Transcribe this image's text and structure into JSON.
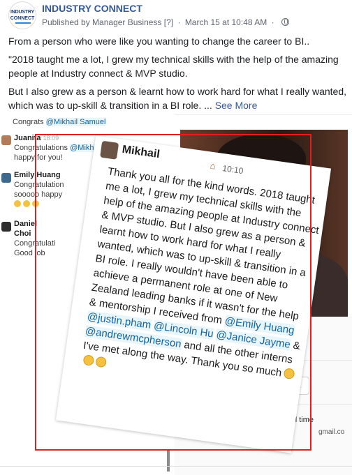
{
  "post": {
    "avatar_line1": "INDUSTRY",
    "avatar_line2": "CONNECT",
    "page_name": "INDUSTRY CONNECT",
    "published_by": "Published by Manager Business",
    "help_mark": "[?]",
    "date": "March 15 at 10:48 AM",
    "privacy_icon": "globe-icon",
    "paragraphs": [
      "From a person who were like you wanting to change the career to BI..",
      "\"2018 taught me a lot, I grew my technical skills with the help of the amazing people at Industry connect & MVP studio.",
      "But I also grew as a person & learnt how to work hard for what I really wanted, which was to up-skill & transition in a BI role. ..."
    ],
    "see_more": "See More"
  },
  "slack": {
    "top_line_prefix": "Congrats",
    "top_line_mention": "@Mikhail Samuel",
    "messages": [
      {
        "name": "Juanita",
        "time": "18:09",
        "text_prefix": "Congratulations",
        "mention": "@Mikhail Samuel",
        "text_suffix": ". So happy for you!"
      },
      {
        "name": "Emily Huang",
        "text": "Congratulation sooooo happy"
      },
      {
        "name": "Daniel Choi",
        "text": "Congratulati Good job"
      }
    ]
  },
  "card": {
    "name": "Mikhail",
    "time": "10:10",
    "body_parts": [
      {
        "t": "Thank you all for the kind words. 2018 taught me a lot, I grew my technical skills with the help of the amazing people at Industry connect & MVP studio. But I also grew as a person & learnt how to work hard for what I really wanted, which was to up-skill & transition in a BI role. I really wouldn't have been able to achieve a permanent role at one of New Zealand leading banks if it wasn't for the help & mentorship I received from "
      },
      {
        "m": "@Emily Huang"
      },
      {
        "t": " "
      },
      {
        "m": "@justin.pham"
      },
      {
        "t": " "
      },
      {
        "m": "@Lincoln Hu"
      },
      {
        "t": " "
      },
      {
        "m": "@Janice Jayme"
      },
      {
        "t": " & "
      },
      {
        "m": "@andrewmcpherson"
      },
      {
        "t": " and all the other interns I've met along the way. Thank you so much"
      }
    ],
    "emoji_count": 3
  },
  "side": {
    "more_button": "...",
    "local_time": "s local time",
    "email_fragment": "gmail.co"
  },
  "colors": {
    "link": "#365899",
    "mention": "#1264a3",
    "selection_box": "#e02020"
  }
}
